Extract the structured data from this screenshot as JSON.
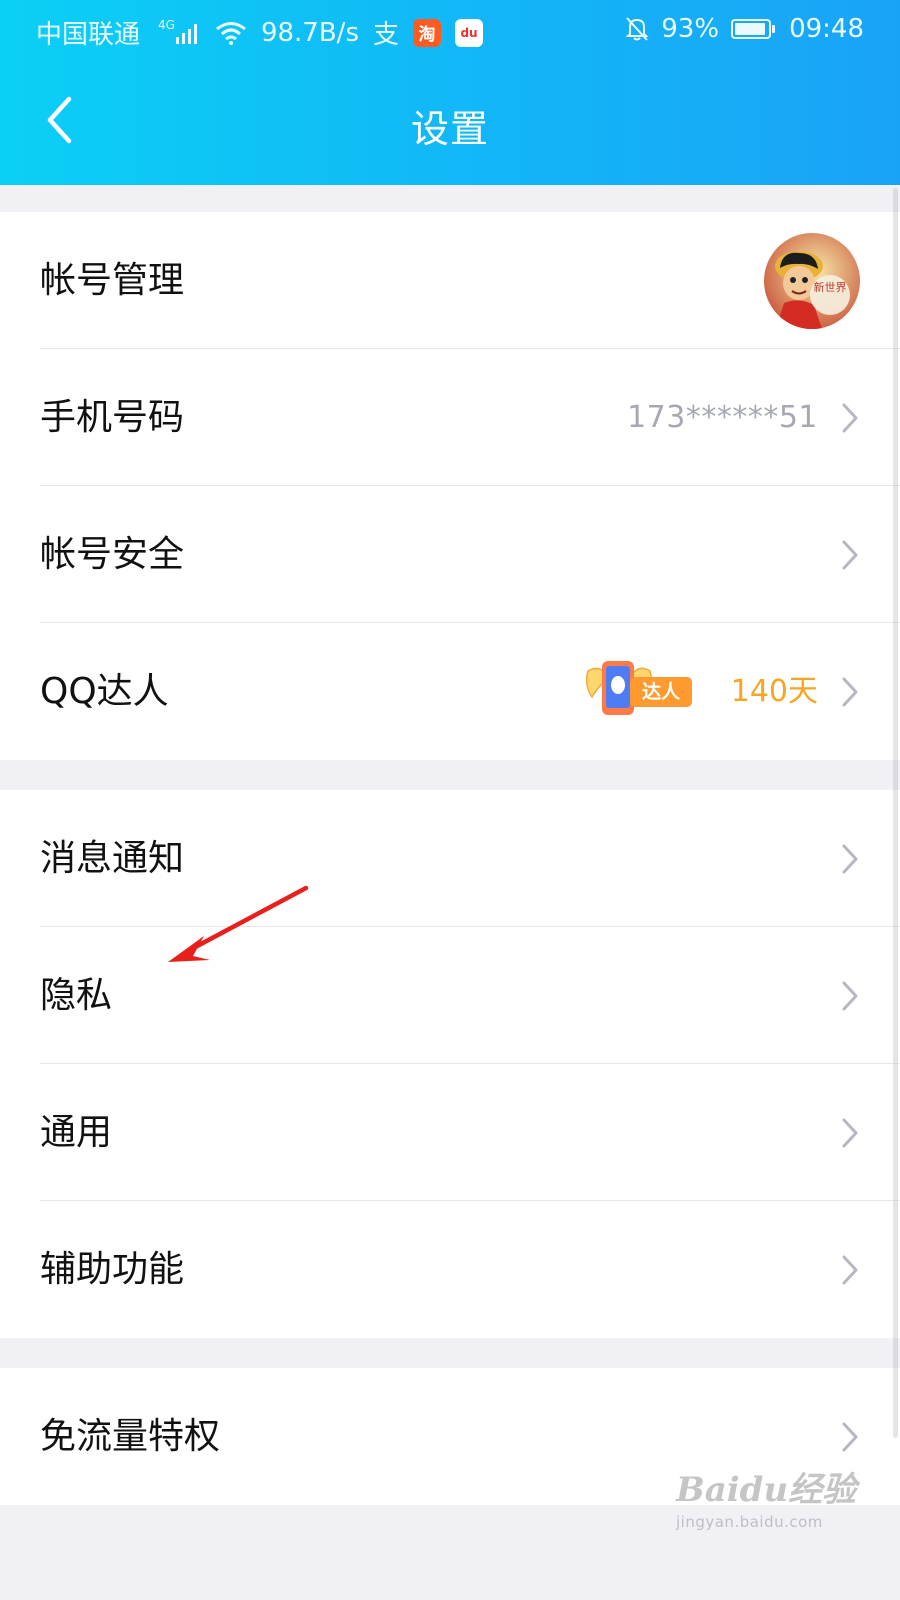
{
  "status_bar": {
    "carrier": "中国联通",
    "network": "4G",
    "speed": "98.7B/s",
    "alipay_icon_text": "支",
    "taobao_icon_text": "淘",
    "map_icon_text": "du",
    "battery": "93%",
    "time": "09:48"
  },
  "header": {
    "title": "设置",
    "back_icon": "chevron-left-icon"
  },
  "groups": [
    {
      "items": [
        {
          "label": "帐号管理",
          "accessory": "avatar",
          "avatar_text": "新世界"
        },
        {
          "label": "手机号码",
          "value": "173******51",
          "accessory": "chevron-right-icon"
        },
        {
          "label": "帐号安全",
          "accessory": "chevron-right-icon"
        },
        {
          "label": "QQ达人",
          "badge": "达人",
          "days": "140天",
          "accessory": "chevron-right-icon"
        }
      ]
    },
    {
      "items": [
        {
          "label": "消息通知",
          "accessory": "chevron-right-icon"
        },
        {
          "label": "隐私",
          "accessory": "chevron-right-icon"
        },
        {
          "label": "通用",
          "accessory": "chevron-right-icon"
        },
        {
          "label": "辅助功能",
          "accessory": "chevron-right-icon"
        }
      ]
    },
    {
      "items": [
        {
          "label": "免流量特权",
          "accessory": "chevron-right-icon"
        }
      ]
    }
  ],
  "watermark": {
    "logo": "Baidu经验",
    "url": "jingyan.baidu.com"
  },
  "colors": {
    "header_gradient_start": "#0bd0f5",
    "header_gradient_end": "#1aa3f6",
    "days_text": "#f5a623",
    "annotation_arrow": "#e8201c"
  }
}
